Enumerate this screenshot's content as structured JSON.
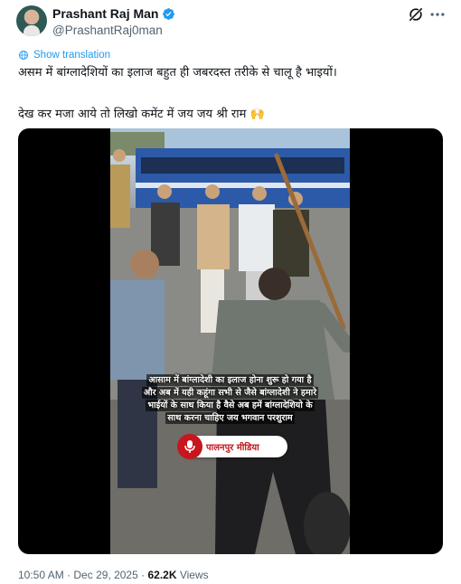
{
  "author": {
    "name": "Prashant Raj Man",
    "handle": "@PrashantRaj0man"
  },
  "post": {
    "translate_label": "Show translation",
    "line1": "असम में बांग्लादेशियों का इलाज बहुत ही जबरदस्त तरीके से चालू है भाइयों।",
    "line2": "देख कर मजा आये तो लिखो कमेंट में जय जय श्री राम 🙌"
  },
  "video": {
    "overlay_line1": "आसाम में बांग्लादेशी का इलाज होना शुरू हो गया है",
    "overlay_line2": "और अब में यही कहूंगा सभी से जैसे बांग्लादेशी ने हमारे",
    "overlay_line3": "भाईयों के साथ किया है वैसे अब हमें बांग्लादेशियो के",
    "overlay_line4": "साथ करना चाहिए जय भगवान परशुराम",
    "channel_name": "पालनपुर मीडिया"
  },
  "meta": {
    "time": "10:50 AM",
    "separator": "·",
    "date": "Dec 29, 2025",
    "views_count": "62.2K",
    "views_label": "Views"
  },
  "colors": {
    "accent": "#1d9bf0",
    "text": "#0f1419",
    "secondary": "#536471",
    "channel_red": "#c7161d"
  },
  "icons": {
    "verified": "verified-badge-icon",
    "grok": "grok-icon",
    "more": "more-icon",
    "translate": "globe-icon"
  }
}
